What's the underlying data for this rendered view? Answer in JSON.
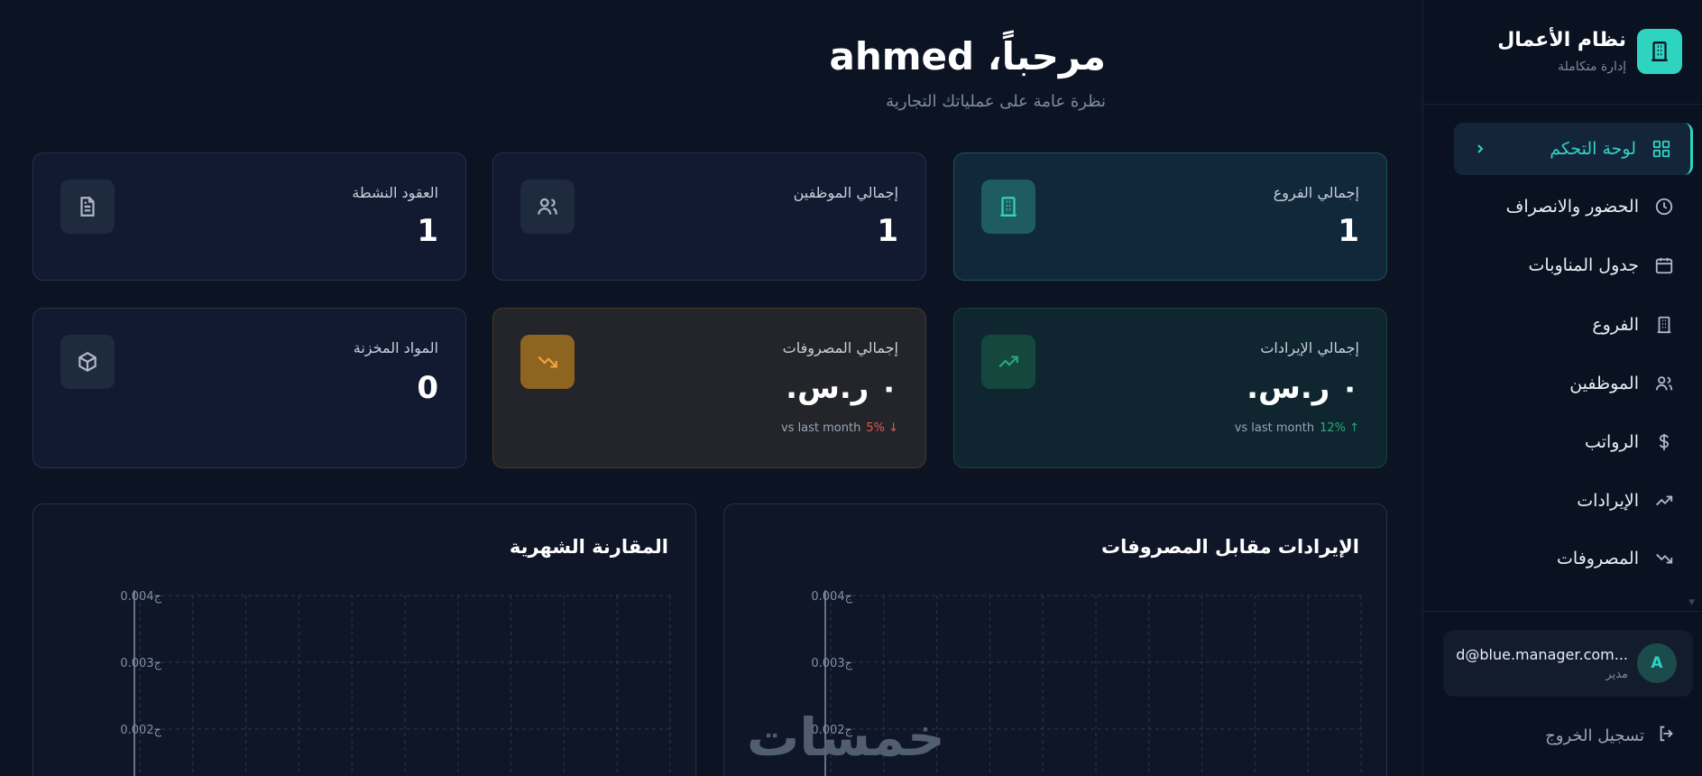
{
  "header": {
    "title": "مرحباً، ahmed",
    "subtitle": "نظرة عامة على عملياتك التجارية"
  },
  "stats": {
    "branches": {
      "label": "إجمالي الفروع",
      "value": "1",
      "icon": "building-icon"
    },
    "employees": {
      "label": "إجمالي الموظفين",
      "value": "1",
      "icon": "users-icon"
    },
    "contracts": {
      "label": "العقود النشطة",
      "value": "1",
      "icon": "document-icon"
    },
    "income": {
      "label": "إجمالي الإيرادات",
      "value": "٠ ر.س.",
      "trend_pct": "12% ↑",
      "trend_text": "vs last month",
      "icon": "trending-up-icon"
    },
    "expenses": {
      "label": "إجمالي المصروفات",
      "value": "٠ ر.س.",
      "trend_pct": "5% ↓",
      "trend_text": "vs last month",
      "icon": "trending-down-icon"
    },
    "inventory": {
      "label": "المواد المخزنة",
      "value": "0",
      "icon": "box-icon"
    }
  },
  "charts": {
    "left_title": "المقارنة الشهرية",
    "right_title": "الإيرادات مقابل المصروفات"
  },
  "chart_data": [
    {
      "type": "bar",
      "title": "المقارنة الشهرية",
      "y_tick_labels": [
        "0.004ج",
        "0.003ج",
        "0.002ج"
      ],
      "ylim": [
        0,
        0.004
      ],
      "grid": true,
      "series": []
    },
    {
      "type": "line",
      "title": "الإيرادات مقابل المصروفات",
      "y_tick_labels": [
        "0.004ج",
        "0.003ج",
        "0.002ج"
      ],
      "ylim": [
        0,
        0.004
      ],
      "grid": true,
      "series": []
    }
  ],
  "watermark": "خمسات",
  "sidebar": {
    "brand_title": "نظام الأعمال",
    "brand_subtitle": "إدارة متكاملة",
    "items": [
      {
        "label": "لوحة التحكم",
        "icon": "dashboard-icon",
        "active": true
      },
      {
        "label": "الحضور والانصراف",
        "icon": "clock-icon"
      },
      {
        "label": "جدول المناوبات",
        "icon": "calendar-icon"
      },
      {
        "label": "الفروع",
        "icon": "building-icon"
      },
      {
        "label": "الموظفين",
        "icon": "users-icon"
      },
      {
        "label": "الرواتب",
        "icon": "dollar-icon"
      },
      {
        "label": "الإيرادات",
        "icon": "trending-up-icon"
      },
      {
        "label": "المصروفات",
        "icon": "trending-down-icon"
      }
    ],
    "user": {
      "email": "d@blue.manager.com...",
      "role": "مدير",
      "initial": "A"
    },
    "logout_label": "تسجيل الخروج"
  },
  "colors": {
    "accent": "#2fd4c0",
    "background": "#0c1424",
    "positive": "#2aa876",
    "negative": "#e05a4f",
    "warning": "#f0a53a"
  }
}
